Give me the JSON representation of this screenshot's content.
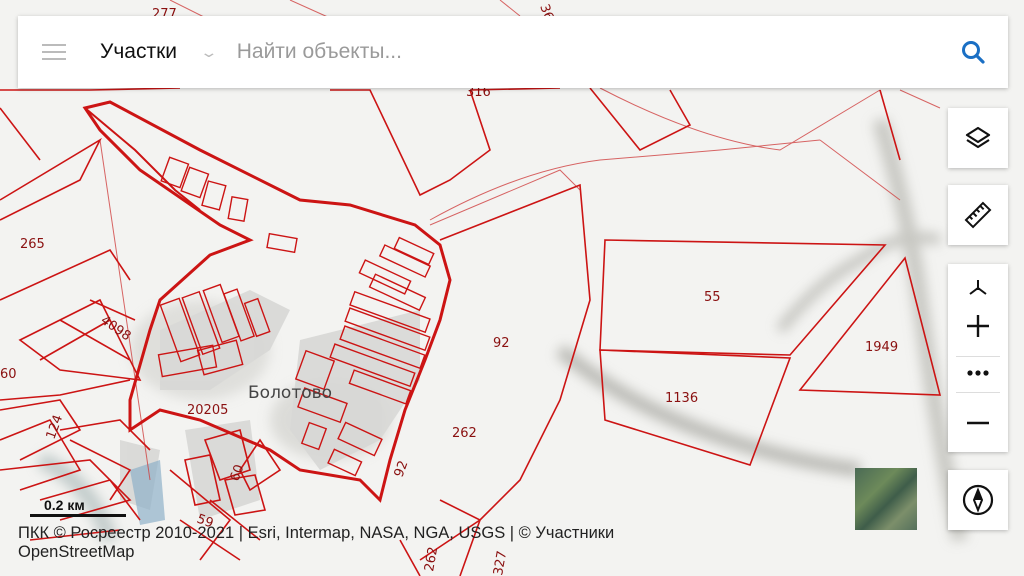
{
  "search": {
    "category": "Участки",
    "placeholder": "Найти объекты..."
  },
  "icons": {
    "menu": "hamburger-menu-icon",
    "dropdown": "chevron-down-icon",
    "search": "search-icon",
    "layers": "layers-icon",
    "measure": "ruler-icon",
    "zoom_in": "plus-icon",
    "more": "more-dots-icon",
    "zoom_out": "minus-icon",
    "compass": "compass-icon"
  },
  "colors": {
    "parcel_border": "#cc1414",
    "accent": "#1a6fc4"
  },
  "map": {
    "place_name": "Болотово",
    "parcel_labels": {
      "p277": "277",
      "p36": "36",
      "p316": "316",
      "p265": "265",
      "p4098": "4098",
      "p60": "60",
      "p92a": "92",
      "p55": "55",
      "p1949": "1949",
      "p1136": "1136",
      "p20205": "20205",
      "p124": "124",
      "p262a": "262",
      "p60b": "60",
      "p92b": "92",
      "p59": "59",
      "p262b": "262",
      "p327": "327"
    }
  },
  "scale": {
    "label": "0.2 км"
  },
  "attribution": "ПКК © Росреестр 2010-2021 | Esri, Intermap, NASA, NGA, USGS | © Участники OpenStreetMap"
}
